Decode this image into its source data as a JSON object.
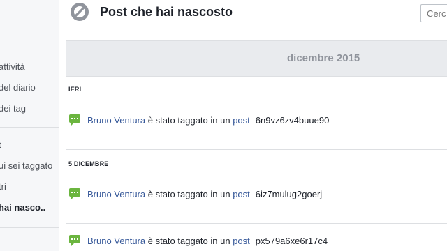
{
  "sidebar": {
    "items": [
      {
        "label": "attività",
        "active": false
      },
      {
        "label": "del diario",
        "active": false
      },
      {
        "label": "dei tag",
        "active": false
      },
      {
        "label": "t",
        "active": false
      },
      {
        "label": "ui sei taggato",
        "active": false
      },
      {
        "label": "tri",
        "active": false
      },
      {
        "label": "hai nasco..",
        "active": true
      }
    ]
  },
  "header": {
    "title": "Post che hai nascosto",
    "search_placeholder": "Cerc"
  },
  "month": "dicembre 2015",
  "groups": [
    {
      "day": "IERI",
      "entries": [
        {
          "user": "Bruno Ventura",
          "action": "è stato taggato in un",
          "object": "post",
          "code": "6n9vz6zv4buue90"
        }
      ]
    },
    {
      "day": "5 DICEMBRE",
      "entries": [
        {
          "user": "Bruno Ventura",
          "action": "è stato taggato in un",
          "object": "post",
          "code": "6iz7mulug2goerj"
        },
        {
          "user": "Bruno Ventura",
          "action": "è stato taggato in un",
          "object": "post",
          "code": "px579a6xe6r17c4"
        }
      ]
    }
  ],
  "colors": {
    "link": "#365899",
    "chat_icon": "#6bb53f",
    "muted": "#90949c"
  }
}
